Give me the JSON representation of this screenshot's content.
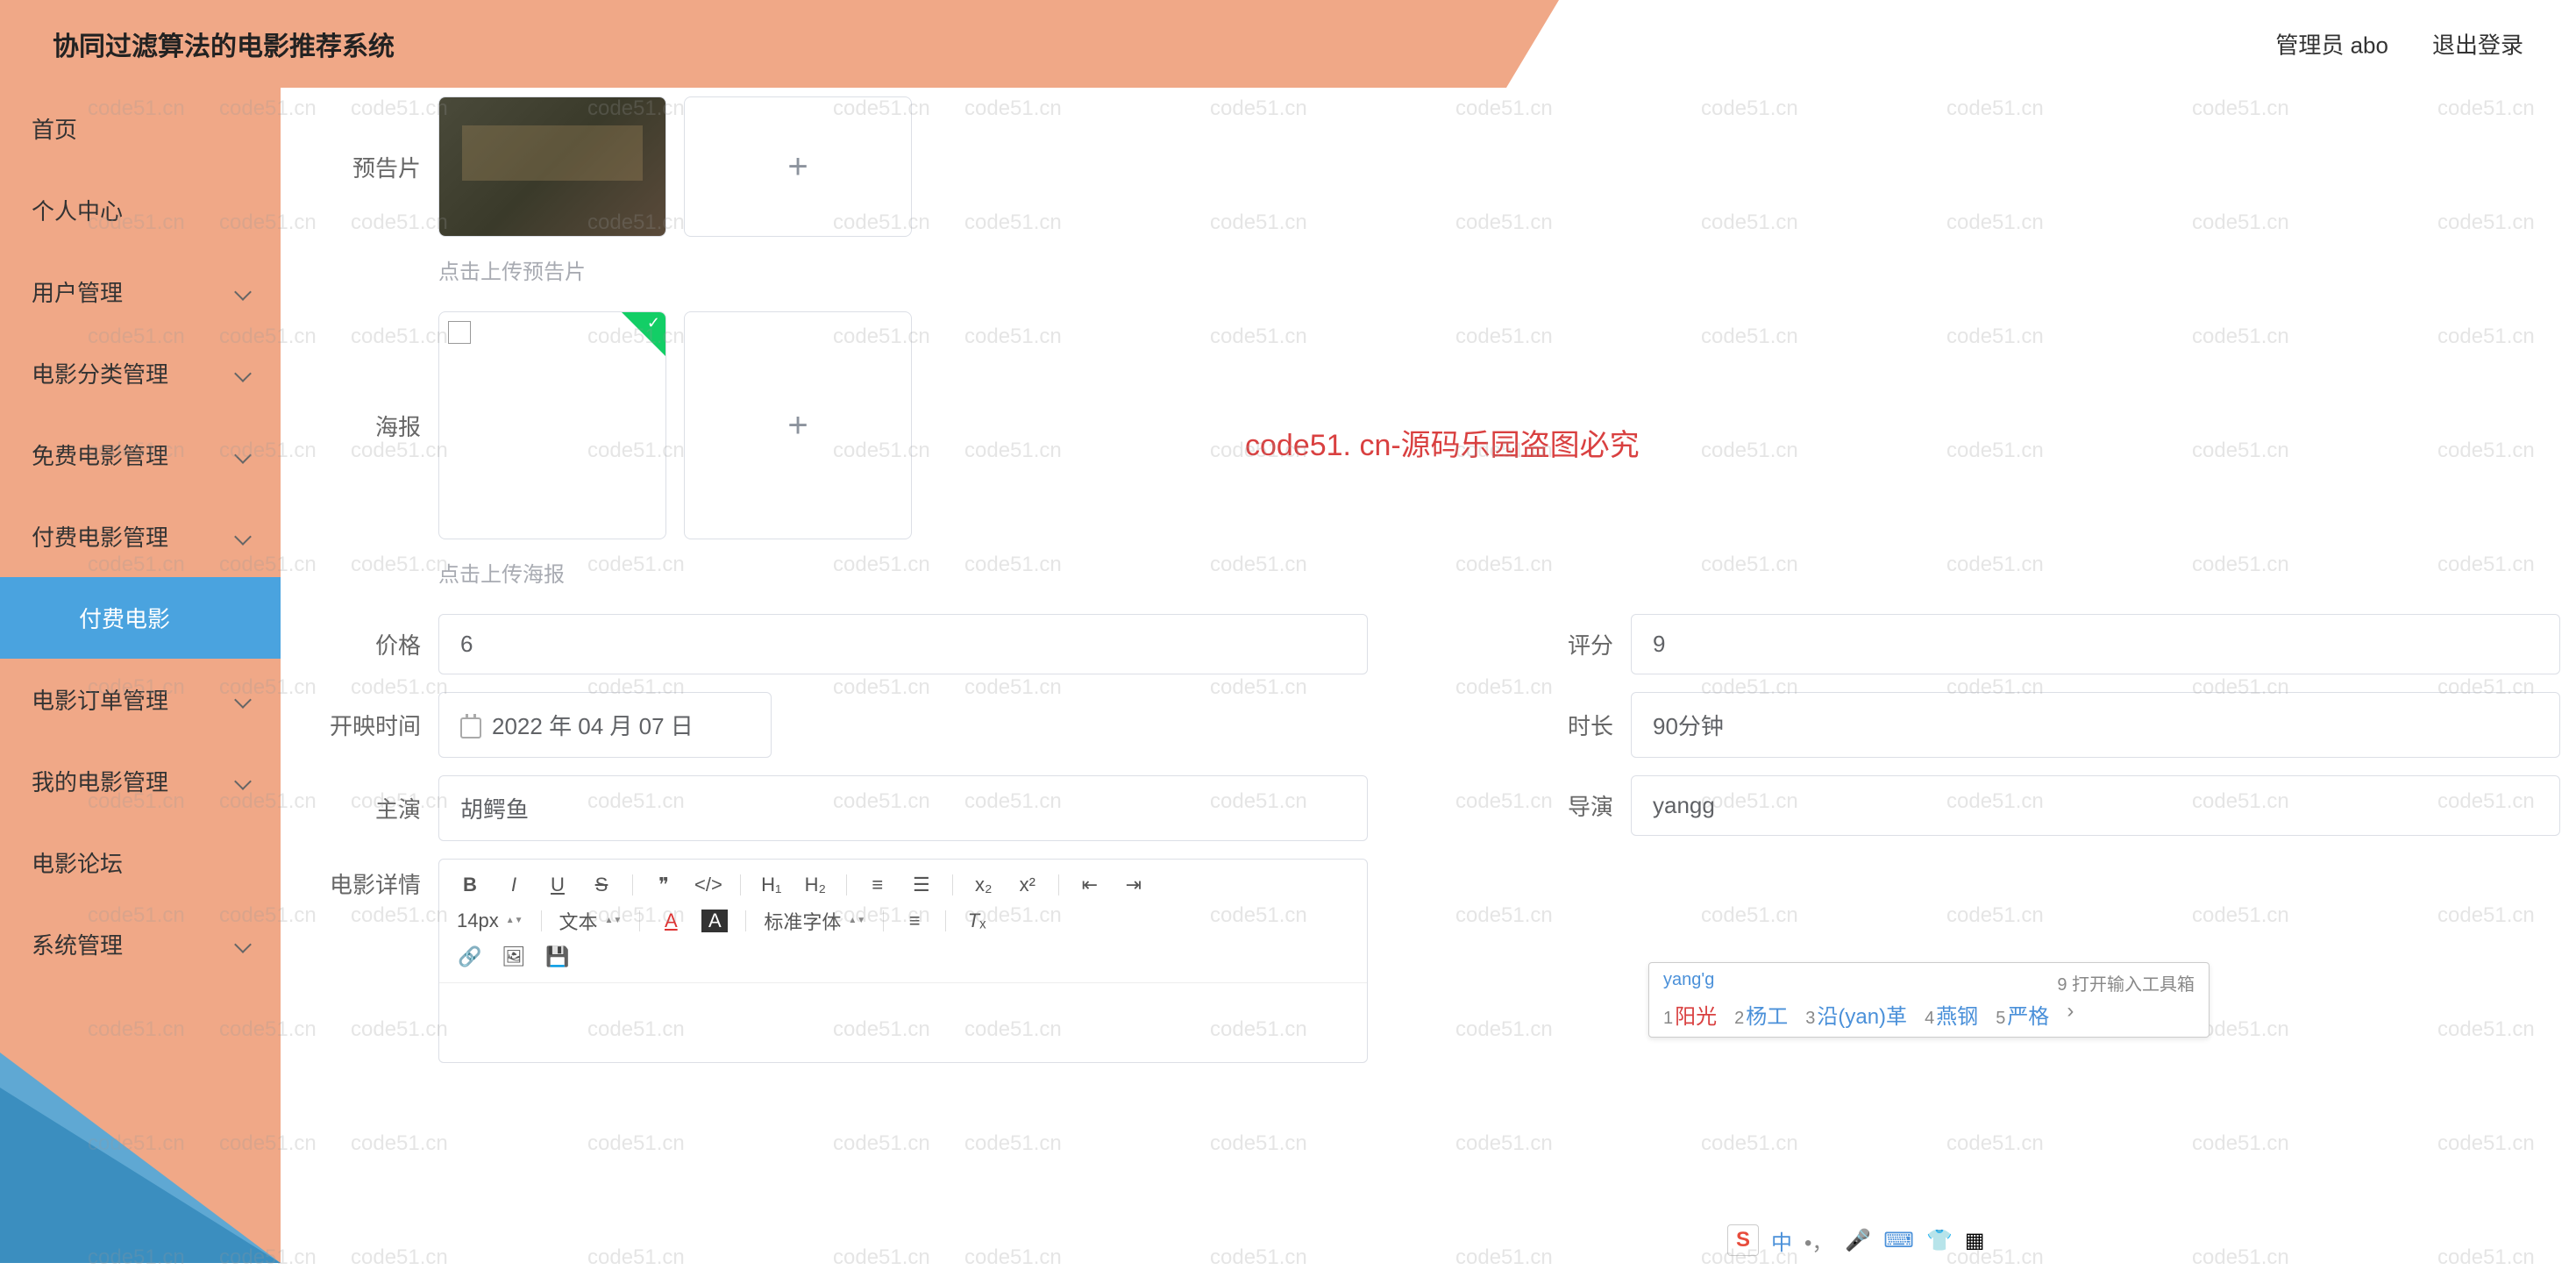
{
  "header": {
    "title": "协同过滤算法的电影推荐系统",
    "admin_label": "管理员 abo",
    "logout_label": "退出登录"
  },
  "sidebar": {
    "items": [
      {
        "label": "首页",
        "expandable": false
      },
      {
        "label": "个人中心",
        "expandable": false
      },
      {
        "label": "用户管理",
        "expandable": true
      },
      {
        "label": "电影分类管理",
        "expandable": true
      },
      {
        "label": "免费电影管理",
        "expandable": true
      },
      {
        "label": "付费电影管理",
        "expandable": true,
        "children": [
          {
            "label": "付费电影"
          }
        ]
      },
      {
        "label": "电影订单管理",
        "expandable": true
      },
      {
        "label": "我的电影管理",
        "expandable": true
      },
      {
        "label": "电影论坛",
        "expandable": false
      },
      {
        "label": "系统管理",
        "expandable": true
      }
    ]
  },
  "form": {
    "trailer_label": "预告片",
    "trailer_hint": "点击上传预告片",
    "poster_label": "海报",
    "poster_hint": "点击上传海报",
    "price_label": "价格",
    "price_value": "6",
    "rating_label": "评分",
    "rating_value": "9",
    "release_label": "开映时间",
    "release_value": "2022 年 04 月 07 日",
    "duration_label": "时长",
    "duration_value": "90分钟",
    "actor_label": "主演",
    "actor_value": "胡鳄鱼",
    "director_label": "导演",
    "director_value": "yangg",
    "detail_label": "电影详情"
  },
  "editor_toolbar": {
    "font_size": "14px",
    "text_label": "文本",
    "font_family": "标准字体"
  },
  "ime": {
    "input": "yang'g",
    "toolbox_label": "9 打开输入工具箱",
    "candidates": [
      {
        "num": "1",
        "text": "阳光"
      },
      {
        "num": "2",
        "text": "杨工"
      },
      {
        "num": "3",
        "text": "沿(yan)革"
      },
      {
        "num": "4",
        "text": "燕钢"
      },
      {
        "num": "5",
        "text": "严格"
      }
    ],
    "bar_lang": "中"
  },
  "watermark": {
    "text": "code51.cn",
    "center": "code51. cn-源码乐园盗图必究"
  }
}
